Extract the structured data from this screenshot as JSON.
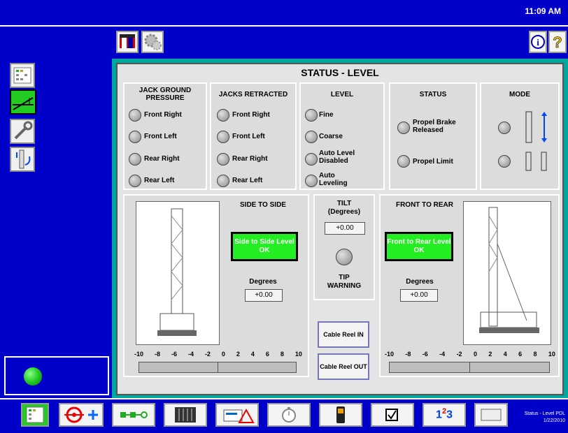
{
  "header": {
    "time": "11:09 AM"
  },
  "toolbar": {
    "left_icons": [
      "gauge-screen-icon",
      "gear-icon"
    ],
    "right_icons": [
      "info-icon",
      "help-icon"
    ]
  },
  "leftnav": {
    "items": [
      "screen-layout-icon",
      "level-icon",
      "wrench-icon",
      "mast-rotate-icon"
    ],
    "indicator_color": "#22cc22"
  },
  "panel": {
    "title": "STATUS - LEVEL",
    "groups": {
      "jack_ground": {
        "header": "JACK GROUND PRESSURE",
        "items": [
          "Front Right",
          "Front Left",
          "Rear Right",
          "Rear Left"
        ]
      },
      "jacks_retracted": {
        "header": "JACKS RETRACTED",
        "items": [
          "Front Right",
          "Front Left",
          "Rear Right",
          "Rear Left"
        ]
      },
      "level": {
        "header": "LEVEL",
        "items": [
          "Fine",
          "Coarse",
          "Auto Level Disabled",
          "Auto Leveling"
        ]
      },
      "status": {
        "header": "STATUS",
        "items": [
          "Propel Brake Released",
          "Propel Limit"
        ]
      },
      "mode": {
        "header": "MODE"
      }
    },
    "side_to_side": {
      "header": "SIDE TO SIDE",
      "ok_text": "Side to Side Level OK",
      "degrees_label": "Degrees",
      "degrees_value": "+0.00"
    },
    "tilt": {
      "header": "TILT",
      "subheader": "(Degrees)",
      "value": "+0.00",
      "tip_label": "TIP",
      "warning_label": "WARNING"
    },
    "cable_reel": {
      "in_label": "Cable Reel IN",
      "out_label": "Cable Reel OUT"
    },
    "front_to_rear": {
      "header": "FRONT TO REAR",
      "ok_text": "Front to Rear Level OK",
      "degrees_label": "Degrees",
      "degrees_value": "+0.00"
    },
    "scale_labels": [
      "-10",
      "-8",
      "-6",
      "-4",
      "-2",
      "0",
      "2",
      "4",
      "6",
      "8",
      "10"
    ]
  },
  "bottombar": {
    "buttons": [
      "screen-layout-icon",
      "target-icon",
      "sequence-icon",
      "panel-icon",
      "chart-warning-icon",
      "timer-icon",
      "phone-icon",
      "checkbox-icon",
      "numbers-icon",
      "blank-screen-icon"
    ],
    "numbers_text": "1",
    "numbers_sup": "2",
    "numbers_end": "3",
    "status_line1": "Status - Level PDL",
    "status_line2": "1/22/2010"
  }
}
